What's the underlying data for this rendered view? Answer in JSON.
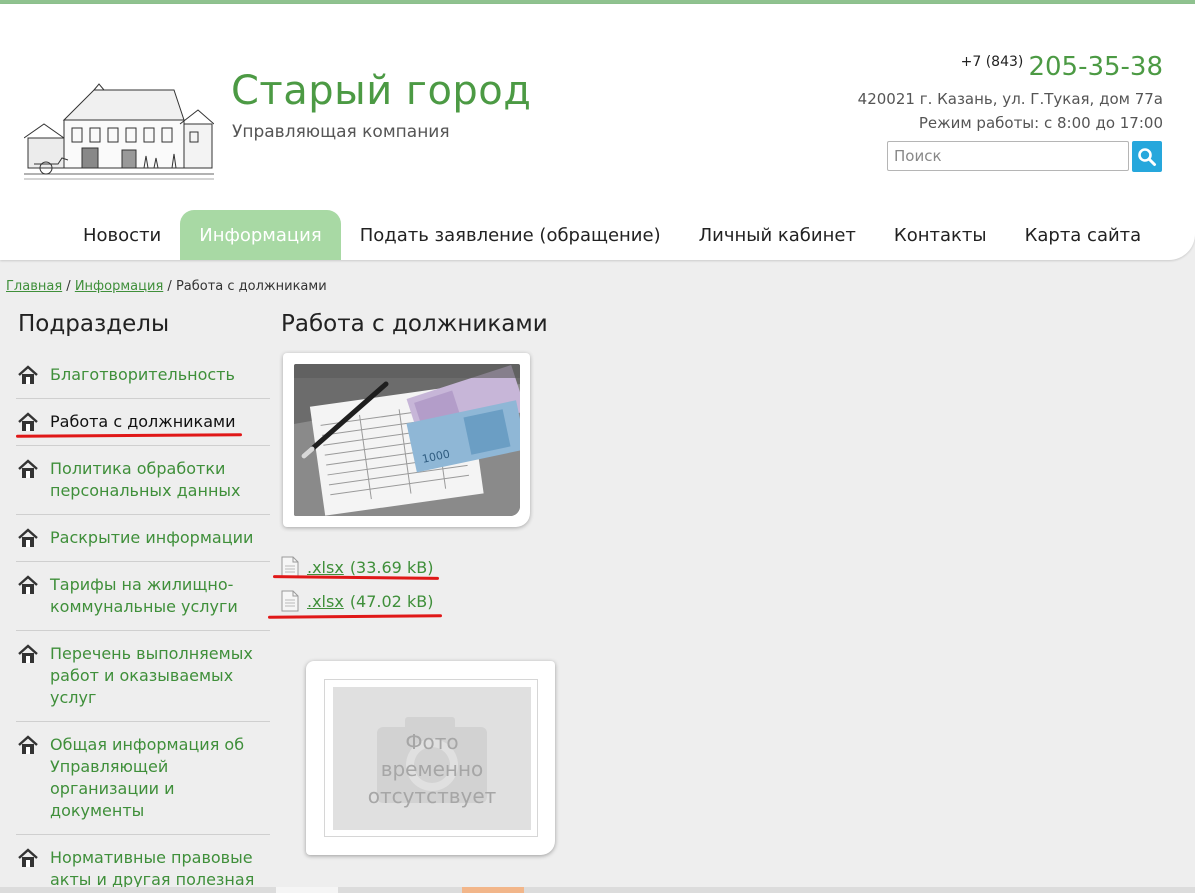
{
  "header": {
    "title": "Старый город",
    "subtitle": "Управляющая компания",
    "phone_prefix": "+7 (843)",
    "phone_number": "205-35-38",
    "address": "420021 г. Казань, ул. Г.Тукая, дом 77а",
    "hours": "Режим работы: с 8:00 до 17:00",
    "search_placeholder": "Поиск"
  },
  "nav": {
    "items": [
      {
        "label": "Новости"
      },
      {
        "label": "Информация",
        "active": true
      },
      {
        "label": "Подать заявление (обращение)"
      },
      {
        "label": "Личный кабинет"
      },
      {
        "label": "Контакты"
      },
      {
        "label": "Карта сайта"
      }
    ]
  },
  "breadcrumb": {
    "home": "Главная",
    "sep1": "/",
    "section": "Информация",
    "sep2": "/",
    "current": "Работа с должниками"
  },
  "sidebar": {
    "title": "Подразделы",
    "items": [
      {
        "label": "Благотворительность"
      },
      {
        "label": "Работа с должниками",
        "current": true
      },
      {
        "label": "Политика обработки персональных данных"
      },
      {
        "label": "Раскрытие информации"
      },
      {
        "label": "Тарифы на жилищно-коммунальные услуги"
      },
      {
        "label": "Перечень выполняемых работ и оказываемых услуг"
      },
      {
        "label": "Общая информация об Управляющей организации и документы"
      },
      {
        "label": "Нормативные правовые акты и другая полезная информация"
      }
    ]
  },
  "content": {
    "title": "Работа с должниками",
    "files": [
      {
        "ext": ".xlsx",
        "size": "(33.69 kB)"
      },
      {
        "ext": ".xlsx",
        "size": "(47.02 kB)"
      }
    ],
    "no_photo": {
      "line1": "Фото",
      "line2": "временно",
      "line3": "отсутствует"
    }
  },
  "colors": {
    "brand_green": "#4c9a44",
    "link_green": "#3f8f3a",
    "nav_active": "#a8d9a4",
    "search_button": "#26a7dc",
    "annotation_red": "#e01818"
  }
}
